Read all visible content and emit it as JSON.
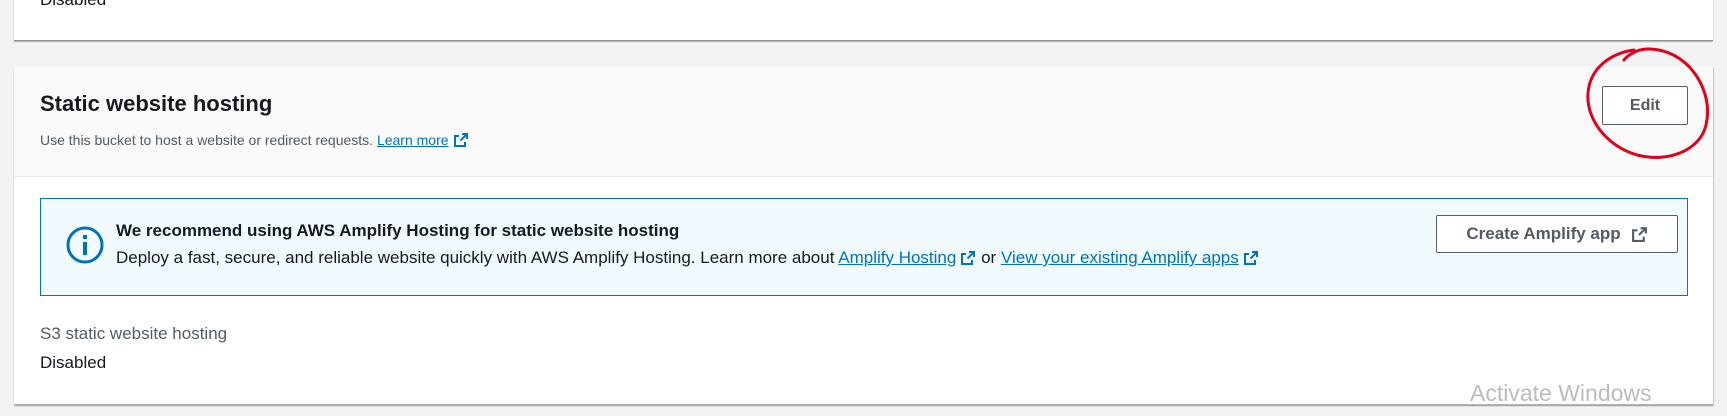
{
  "previous_card": {
    "value": "Disabled"
  },
  "static_hosting": {
    "title": "Static website hosting",
    "description": "Use this bucket to host a website or redirect requests.",
    "learn_more_link": "Learn more",
    "edit_button": "Edit",
    "alert": {
      "title": "We recommend using AWS Amplify Hosting for static website hosting",
      "body_prefix": "Deploy a fast, secure, and reliable website quickly with AWS Amplify Hosting. Learn more about",
      "link_1": "Amplify Hosting",
      "joiner": "or",
      "link_2": "View your existing Amplify apps",
      "button": "Create Amplify app"
    },
    "field": {
      "label": "S3 static website hosting",
      "value": "Disabled"
    }
  },
  "os_watermark": "Activate Windows",
  "colors": {
    "link": "#0073bb",
    "alert_border": "#0073bb",
    "alert_bg": "#f1faff",
    "annotation": "#e3001b"
  },
  "annotation": {
    "type": "hand-drawn circle",
    "target": "edit-button"
  }
}
